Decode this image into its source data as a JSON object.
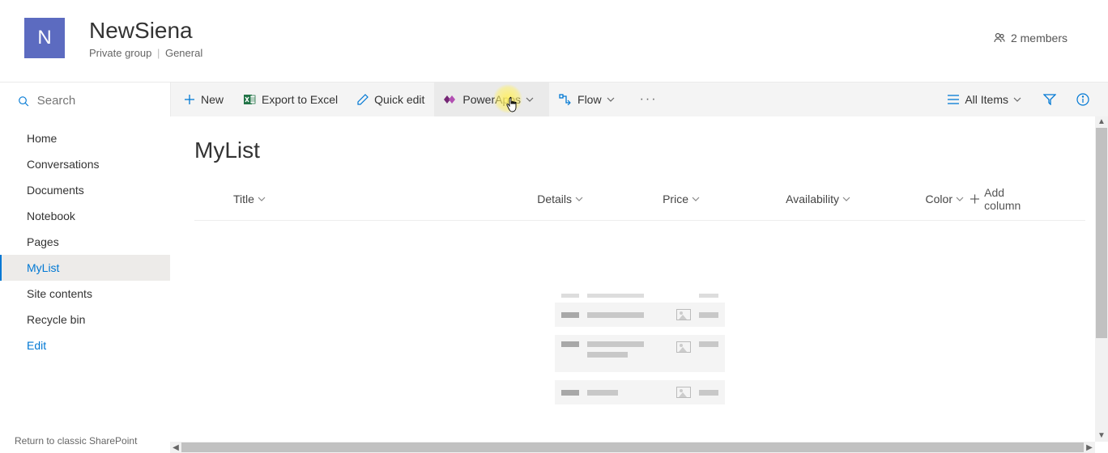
{
  "header": {
    "logo_letter": "N",
    "title": "NewSiena",
    "visibility": "Private group",
    "classification": "General",
    "members_label": "2 members"
  },
  "search": {
    "placeholder": "Search"
  },
  "nav": {
    "items": [
      {
        "label": "Home"
      },
      {
        "label": "Conversations"
      },
      {
        "label": "Documents"
      },
      {
        "label": "Notebook"
      },
      {
        "label": "Pages"
      },
      {
        "label": "MyList"
      },
      {
        "label": "Site contents"
      },
      {
        "label": "Recycle bin"
      },
      {
        "label": "Edit"
      }
    ],
    "classic_link": "Return to classic SharePoint"
  },
  "commands": {
    "new": "New",
    "export": "Export to Excel",
    "quick_edit": "Quick edit",
    "powerapps": "PowerApps",
    "flow": "Flow",
    "view": "All Items"
  },
  "list": {
    "title": "MyList",
    "columns": {
      "title": "Title",
      "details": "Details",
      "price": "Price",
      "availability": "Availability",
      "color": "Color",
      "add": "Add column"
    }
  }
}
